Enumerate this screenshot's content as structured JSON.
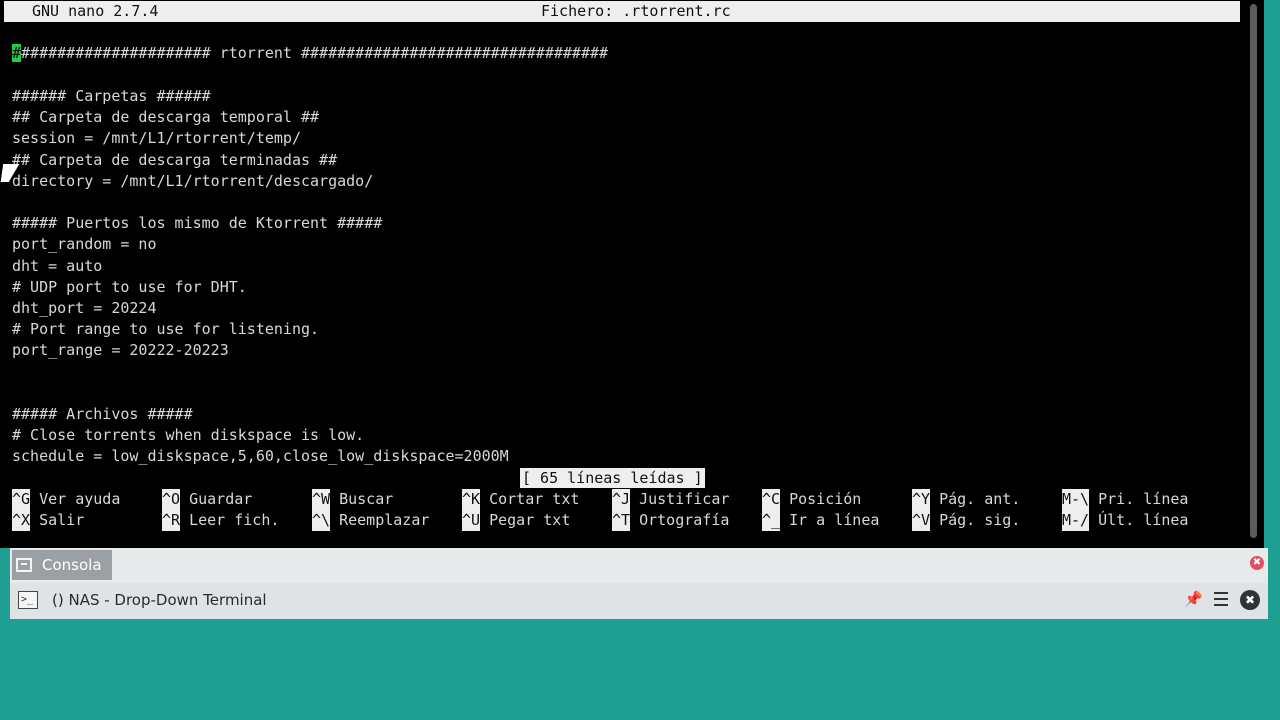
{
  "nano": {
    "version": "GNU nano 2.7.4",
    "file_label": "Fichero: .rtorrent.rc",
    "cursor_char": "#",
    "first_line_rest": "##################### rtorrent ##################################",
    "lines": [
      "###### Carpetas ######",
      "## Carpeta de descarga temporal ##",
      "session = /mnt/L1/rtorrent/temp/",
      "## Carpeta de descarga terminadas ##",
      "directory = /mnt/L1/rtorrent/descargado/",
      "",
      "##### Puertos los mismo de Ktorrent #####",
      "port_random = no",
      "dht = auto",
      "# UDP port to use for DHT.",
      "dht_port = 20224",
      "# Port range to use for listening.",
      "port_range = 20222-20223",
      "",
      "",
      "##### Archivos #####",
      "# Close torrents when diskspace is low.",
      "schedule = low_diskspace,5,60,close_low_diskspace=2000M"
    ],
    "status": "[ 65 líneas leídas ]",
    "shortcuts": [
      {
        "key": "^G",
        "label": "Ver ayuda"
      },
      {
        "key": "^O",
        "label": "Guardar"
      },
      {
        "key": "^W",
        "label": "Buscar"
      },
      {
        "key": "^K",
        "label": "Cortar txt"
      },
      {
        "key": "^J",
        "label": "Justificar"
      },
      {
        "key": "^C",
        "label": "Posición"
      },
      {
        "key": "^Y",
        "label": "Pág. ant."
      },
      {
        "key": "M-\\",
        "label": "Pri. línea"
      },
      {
        "key": "^X",
        "label": "Salir"
      },
      {
        "key": "^R",
        "label": "Leer fich."
      },
      {
        "key": "^\\",
        "label": "Reemplazar"
      },
      {
        "key": "^U",
        "label": "Pegar txt"
      },
      {
        "key": "^T",
        "label": "Ortografía"
      },
      {
        "key": "^_",
        "label": "Ir a línea"
      },
      {
        "key": "^V",
        "label": "Pág. sig."
      },
      {
        "key": "M-/",
        "label": "Últ. línea"
      }
    ]
  },
  "panel": {
    "tab_label": "Consola",
    "window_title": "() NAS - Drop-Down Terminal",
    "close_tab_glyph": "✖",
    "pin_glyph": "📌",
    "close_window_glyph": "✖",
    "term_icon_glyph": ">_"
  }
}
